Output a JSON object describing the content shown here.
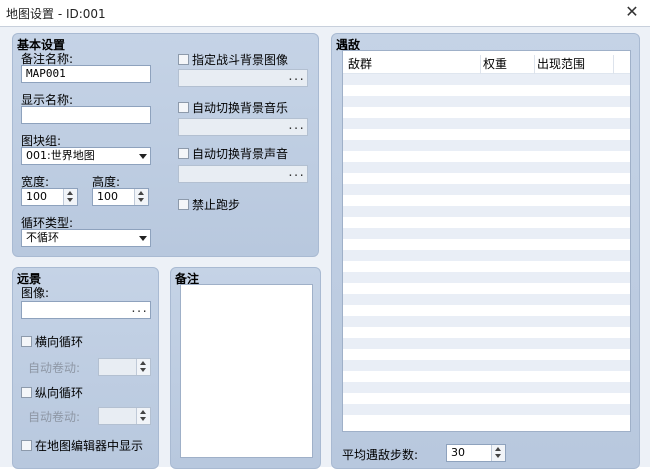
{
  "window": {
    "title": "地图设置 - ID:001",
    "close_glyph": "✕"
  },
  "basic": {
    "heading": "基本设置",
    "note_label": "备注名称:",
    "note_value": "MAP001",
    "display_label": "显示名称:",
    "display_value": "",
    "tileset_label": "图块组:",
    "tileset_value": "001:世界地图",
    "width_label": "宽度:",
    "width_value": "100",
    "height_label": "高度:",
    "height_value": "100",
    "loop_label": "循环类型:",
    "loop_value": "不循环",
    "battleback_label": "指定战斗背景图像",
    "autobgm_label": "自动切换背景音乐",
    "autobgs_label": "自动切换背景声音",
    "nodash_label": "禁止跑步",
    "ellipsis": "..."
  },
  "parallax": {
    "heading": "远景",
    "image_label": "图像:",
    "ellipsis": "...",
    "hloop_label": "横向循环",
    "hscroll_label": "自动卷动:",
    "vloop_label": "纵向循环",
    "vscroll_label": "自动卷动:",
    "show_label": "在地图编辑器中显示"
  },
  "notes": {
    "heading": "备注"
  },
  "encounters": {
    "heading": "遇敌",
    "columns": [
      "敌群",
      "权重",
      "出现范围"
    ],
    "steps_label": "平均遇敌步数:",
    "steps_value": "30"
  }
}
